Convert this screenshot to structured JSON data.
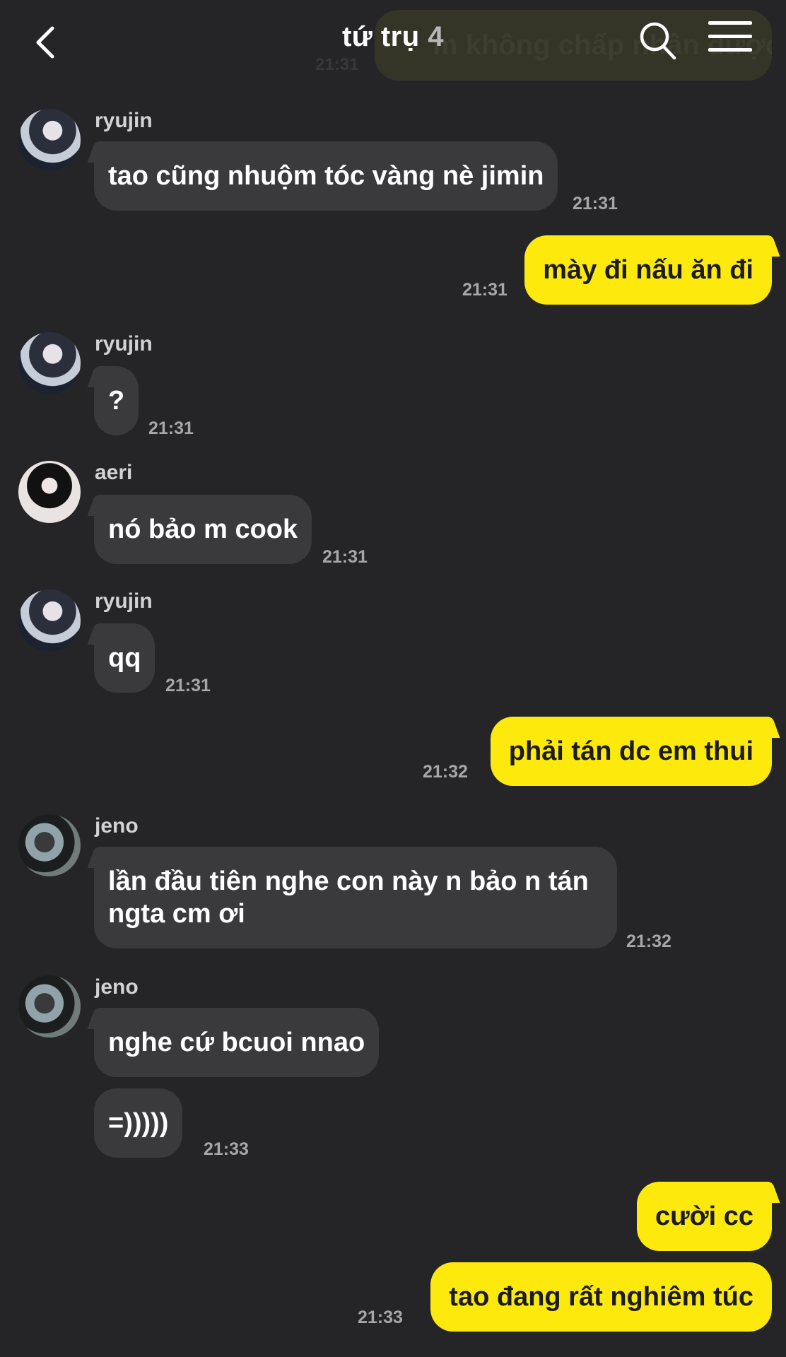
{
  "header": {
    "title": "tứ trụ",
    "title_count": "4",
    "ghost_banner": "m không chấp nhận được",
    "ghost_time": "21:31"
  },
  "messages": [
    {
      "sender": "ryujin",
      "text": "tao cũng nhuộm tóc vàng nè jimin",
      "time": "21:31"
    },
    {
      "sender": "me",
      "text": "mày đi nấu ăn đi",
      "time": "21:31"
    },
    {
      "sender": "ryujin",
      "text": "?",
      "time": "21:31"
    },
    {
      "sender": "aeri",
      "text": "nó bảo m cook",
      "time": "21:31"
    },
    {
      "sender": "ryujin",
      "text": "qq",
      "time": "21:31"
    },
    {
      "sender": "me",
      "text": "phải tán dc em thui",
      "time": "21:32"
    },
    {
      "sender": "jeno",
      "text_line1": "lần đầu tiên nghe con này n bảo n tán",
      "text_line2": "ngta cm ơi",
      "time": "21:32"
    },
    {
      "sender": "jeno",
      "text": "nghe cứ bcuoi nnao"
    },
    {
      "sender": "jeno",
      "text": "=)))))",
      "time": "21:33"
    },
    {
      "sender": "me",
      "text": "cười cc"
    },
    {
      "sender": "me",
      "text": "tao đang rất nghiêm túc",
      "time": "21:33"
    }
  ],
  "colors": {
    "background": "#252528",
    "incoming_bubble": "#3a3a3d",
    "outgoing_bubble": "#fdea0c"
  }
}
